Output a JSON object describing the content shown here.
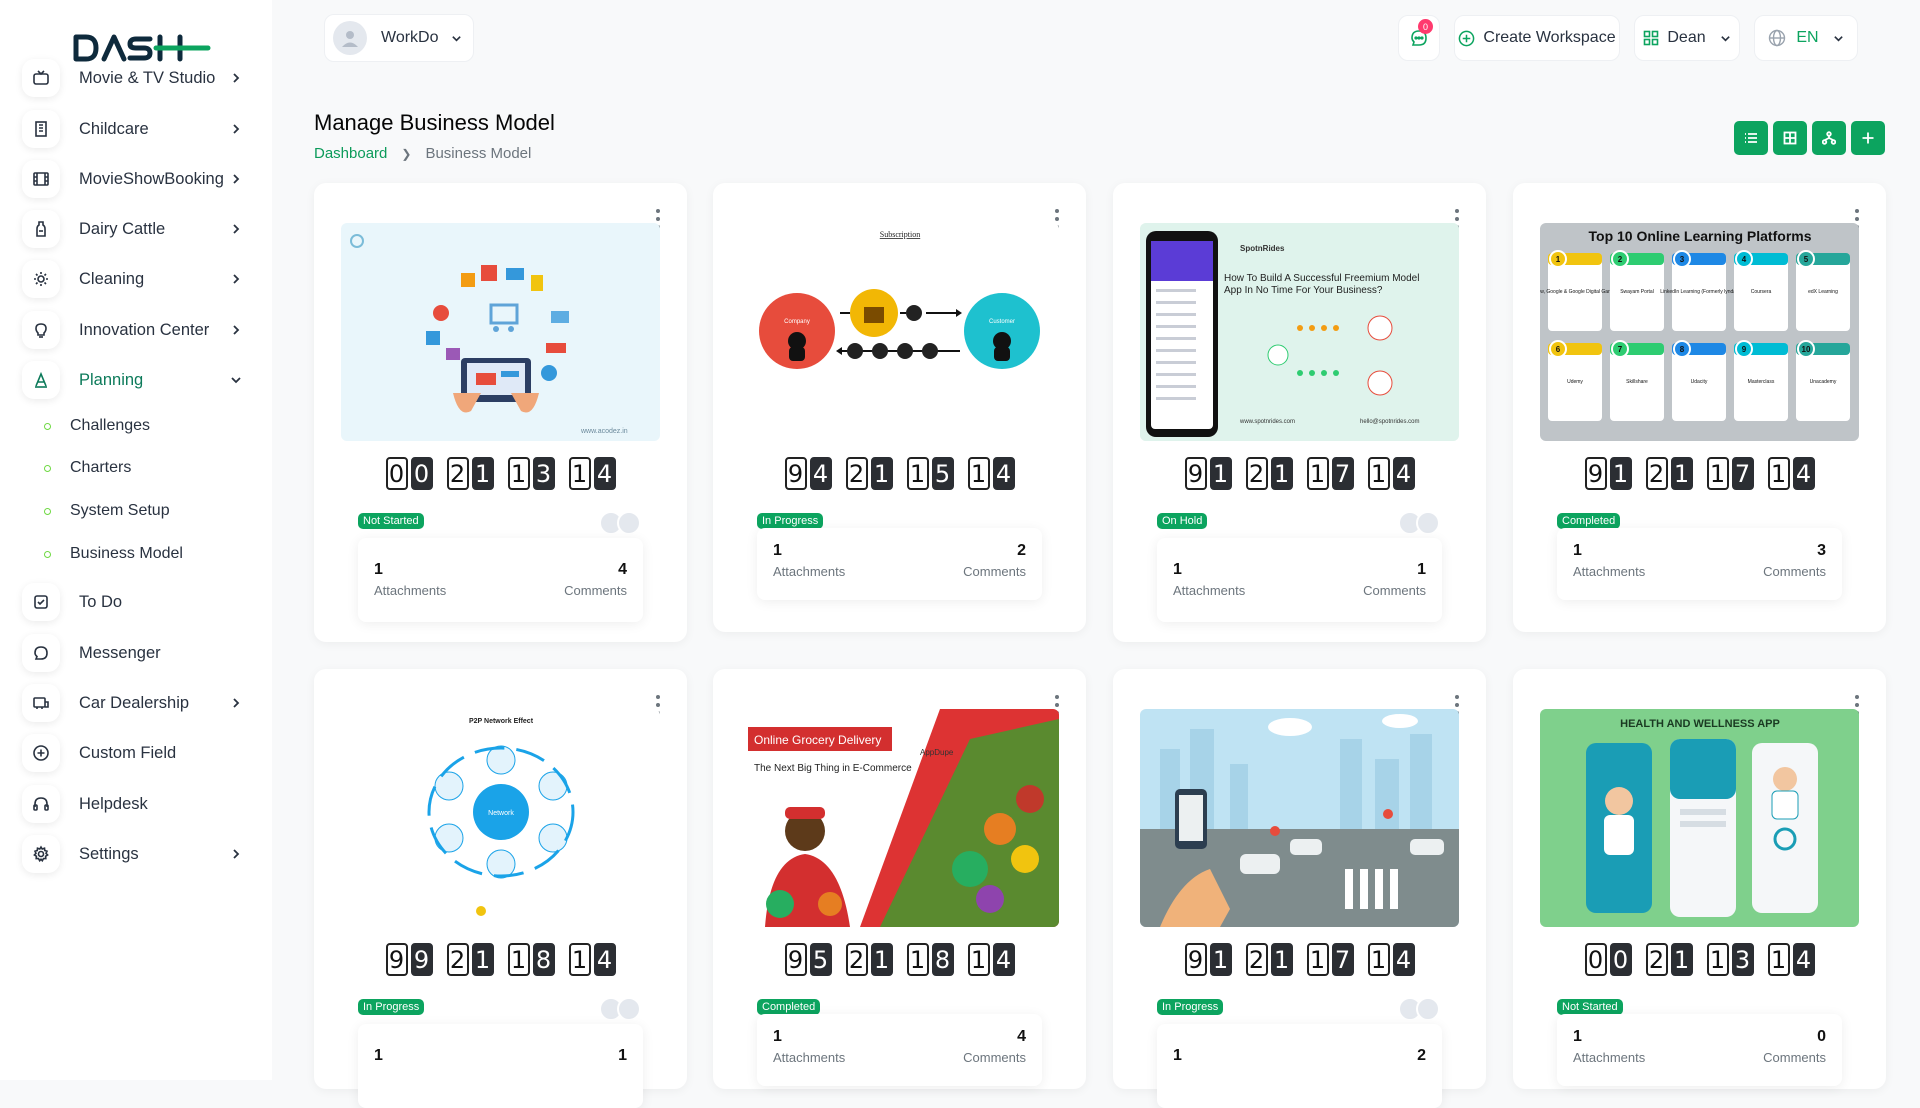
{
  "brand": {
    "logo_text": "DASH"
  },
  "sidebar": {
    "items": [
      {
        "label": "Movie & TV Studio",
        "icon": "tv-icon",
        "chevron": true
      },
      {
        "label": "Childcare",
        "icon": "building-icon",
        "chevron": true
      },
      {
        "label": "MovieShowBooking",
        "icon": "film-icon",
        "chevron": true
      },
      {
        "label": "Dairy Cattle",
        "icon": "bottle-icon",
        "chevron": true
      },
      {
        "label": "Cleaning",
        "icon": "sparkle-icon",
        "chevron": true
      },
      {
        "label": "Innovation Center",
        "icon": "bulb-icon",
        "chevron": true
      },
      {
        "label": "Planning",
        "icon": "planning-icon",
        "chevron": true,
        "active": true
      },
      {
        "label": "To Do",
        "icon": "checklist-icon",
        "chevron": false
      },
      {
        "label": "Messenger",
        "icon": "chat-icon",
        "chevron": false
      },
      {
        "label": "Car Dealership",
        "icon": "car-icon",
        "chevron": true
      },
      {
        "label": "Custom Field",
        "icon": "plus-circle-icon",
        "chevron": false
      },
      {
        "label": "Helpdesk",
        "icon": "headset-icon",
        "chevron": false
      },
      {
        "label": "Settings",
        "icon": "gear-icon",
        "chevron": true
      }
    ],
    "planning_sub": [
      "Challenges",
      "Charters",
      "System Setup",
      "Business Model"
    ]
  },
  "topbar": {
    "workspace": "WorkDo",
    "notifications": "0",
    "create_workspace": "Create Workspace",
    "user": "Dean",
    "language": "EN"
  },
  "page": {
    "title": "Manage Business Model",
    "breadcrumb": [
      "Dashboard",
      "Business Model"
    ]
  },
  "cards": [
    {
      "digits": [
        "00",
        "21",
        "13",
        "14"
      ],
      "status": "Not Started",
      "attachments": "1",
      "attachments_label": "Attachments",
      "comments": "4",
      "comments_label": "Comments",
      "avatars": true,
      "thumb": "ecommerce"
    },
    {
      "digits": [
        "94",
        "21",
        "15",
        "14"
      ],
      "status": "In Progress",
      "attachments": "1",
      "attachments_label": "Attachments",
      "comments": "2",
      "comments_label": "Comments",
      "avatars": false,
      "thumb": "subscription"
    },
    {
      "digits": [
        "91",
        "21",
        "17",
        "14"
      ],
      "status": "On Hold",
      "attachments": "1",
      "attachments_label": "Attachments",
      "comments": "1",
      "comments_label": "Comments",
      "avatars": true,
      "thumb": "freemium"
    },
    {
      "digits": [
        "91",
        "21",
        "17",
        "14"
      ],
      "status": "Completed",
      "attachments": "1",
      "attachments_label": "Attachments",
      "comments": "3",
      "comments_label": "Comments",
      "avatars": false,
      "thumb": "learning"
    },
    {
      "digits": [
        "99",
        "21",
        "18",
        "14"
      ],
      "status": "In Progress",
      "attachments": "1",
      "attachments_label": "",
      "comments": "1",
      "comments_label": "",
      "avatars": true,
      "thumb": "network"
    },
    {
      "digits": [
        "95",
        "21",
        "18",
        "14"
      ],
      "status": "Completed",
      "attachments": "1",
      "attachments_label": "Attachments",
      "comments": "4",
      "comments_label": "Comments",
      "avatars": false,
      "thumb": "grocery"
    },
    {
      "digits": [
        "91",
        "21",
        "17",
        "14"
      ],
      "status": "In Progress",
      "attachments": "1",
      "attachments_label": "",
      "comments": "2",
      "comments_label": "",
      "avatars": true,
      "thumb": "carshare"
    },
    {
      "digits": [
        "00",
        "21",
        "13",
        "14"
      ],
      "status": "Not Started",
      "attachments": "1",
      "attachments_label": "Attachments",
      "comments": "0",
      "comments_label": "Comments",
      "avatars": false,
      "thumb": "health"
    }
  ],
  "thumb_text": {
    "subscription_title": "Subscription",
    "subscription_company": "Company",
    "subscription_customer": "Customer",
    "freemium_brand": "SpotnRides",
    "freemium_title": "How To Build A Successful Freemium Model App In No Time For Your Business?",
    "learning_title": "Top 10 Online Learning Platforms",
    "learning_items": [
      "Grow, Google & Google Digital Garage",
      "Swayam Portal",
      "LinkedIn Learning (Formerly lynda)",
      "Coursera",
      "edX Learning",
      "Udemy",
      "Skillshare",
      "Udacity",
      "Masterclass",
      "Unacademy"
    ],
    "network_title": "P2P Network Effect",
    "network_center": "Network",
    "grocery_title": "Online Grocery Delivery",
    "grocery_sub": "The Next Big Thing in E-Commerce",
    "grocery_brand": "AppDupe",
    "health_title": "HEALTH AND WELLNESS APP"
  },
  "colors": {
    "brand_green": "#0ca45f",
    "text_dark": "#293240",
    "page_bg": "#f8f9fa"
  }
}
